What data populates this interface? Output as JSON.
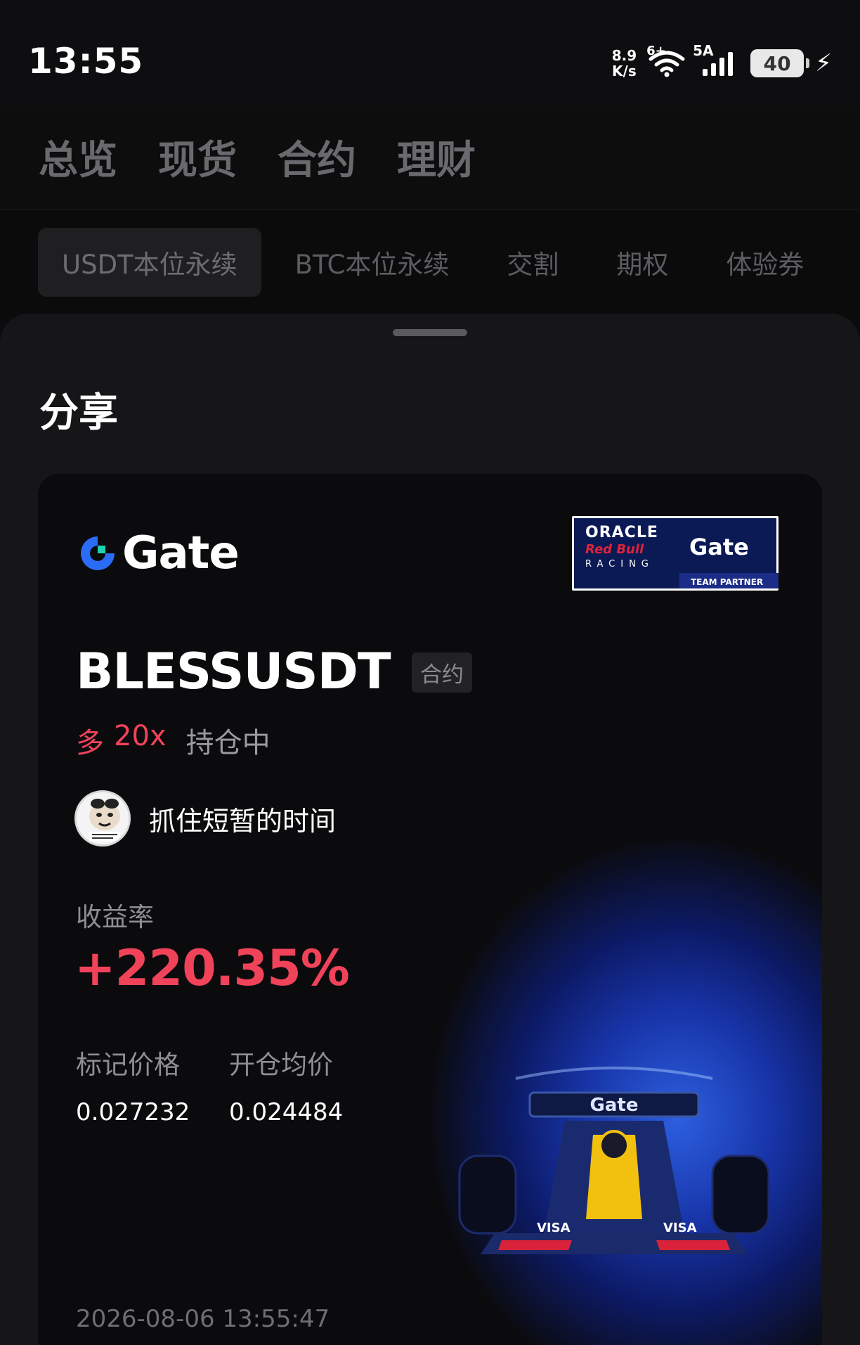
{
  "status_bar": {
    "time": "13:55",
    "net_speed_value": "8.9",
    "net_speed_unit": "K/s",
    "wifi_label": "6+",
    "signal_label": "5A",
    "battery_level": "40",
    "battery_fraction": 0.4
  },
  "main_tabs": [
    {
      "label": "总览"
    },
    {
      "label": "现货"
    },
    {
      "label": "合约"
    },
    {
      "label": "理财"
    }
  ],
  "sub_tabs": [
    {
      "label": "USDT本位永续",
      "active": true
    },
    {
      "label": "BTC本位永续"
    },
    {
      "label": "交割"
    },
    {
      "label": "期权"
    },
    {
      "label": "体验券"
    }
  ],
  "sheet": {
    "title": "分享"
  },
  "card": {
    "brand": "Gate",
    "partner": {
      "oracle": "ORACLE",
      "redbull": "Red Bull",
      "racing": "RACING",
      "gate": "Gate",
      "tag": "TEAM PARTNER"
    },
    "symbol": "BLESSUSDT",
    "contract_tag": "合约",
    "side": "多",
    "leverage": "20x",
    "status": "持仓中",
    "user_name": "抓住短暂的时间",
    "roi_label": "收益率",
    "roi_value": "+220.35%",
    "mark_price_label": "标记价格",
    "mark_price": "0.027232",
    "entry_price_label": "开仓均价",
    "entry_price": "0.024484",
    "timestamp": "2026-08-06 13:55:47"
  },
  "colors": {
    "accent_red": "#f0435a",
    "gate_blue": "#2a6cf5",
    "background": "#0c0c0e"
  }
}
